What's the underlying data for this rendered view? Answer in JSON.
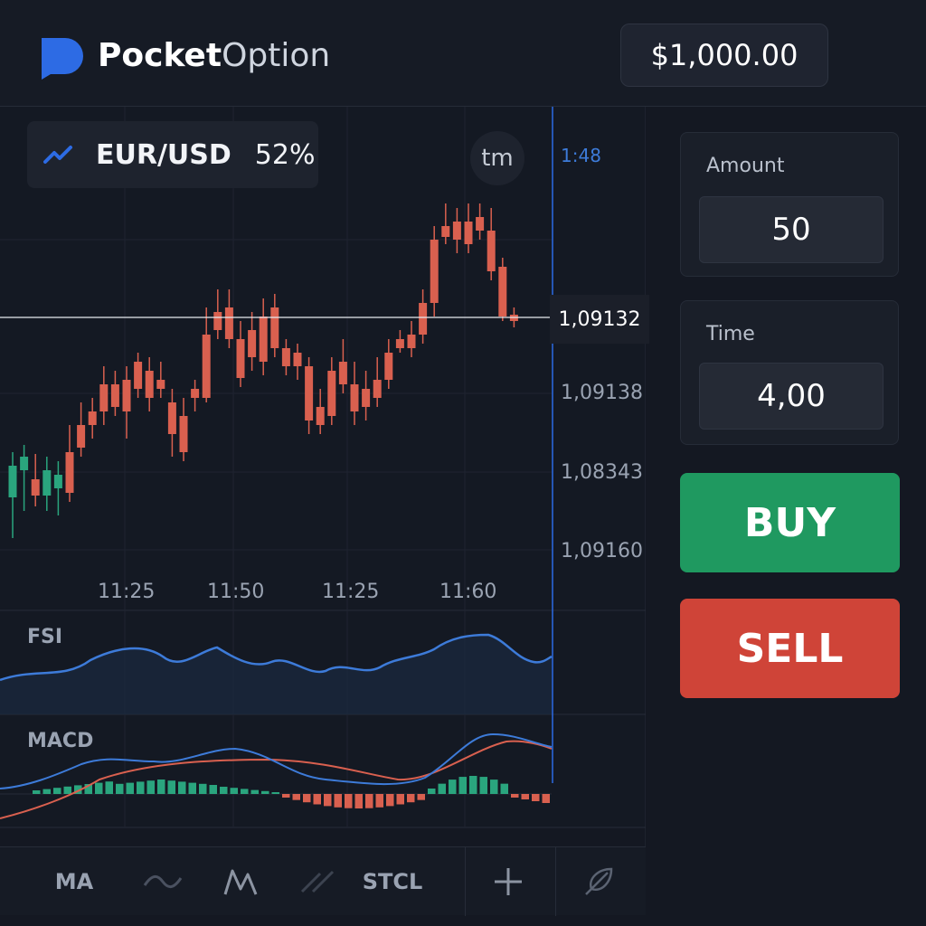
{
  "brand": {
    "bold": "Pocket",
    "light": "Option"
  },
  "balance": "$1,000.00",
  "asset": {
    "name": "EUR/USD",
    "payout": "52%"
  },
  "tm_button": "tm",
  "timer": "1:48",
  "current_price": "1,09132",
  "price_axis": [
    "1,09138",
    "1,08343",
    "1,09160"
  ],
  "time_axis": [
    "11:25",
    "11:50",
    "11:25",
    "11:60"
  ],
  "indicators": {
    "fsi": "FSI",
    "macd": "MACD"
  },
  "amount": {
    "label": "Amount",
    "value": "50"
  },
  "time": {
    "label": "Time",
    "value": "4,00"
  },
  "buttons": {
    "buy": "BUY",
    "sell": "SELL"
  },
  "toolbar": {
    "ma": "MA",
    "stcl": "STCL"
  },
  "colors": {
    "up": "#2aa57e",
    "down": "#d9604f",
    "accent": "#3d7bd9",
    "buy": "#1f9960",
    "sell": "#cf4438"
  },
  "icons": [
    "pocket-option-logo-icon",
    "trend-icon",
    "wave-icon",
    "zigzag-icon",
    "diagonal-lines-icon",
    "plus-icon",
    "feather-icon"
  ]
}
